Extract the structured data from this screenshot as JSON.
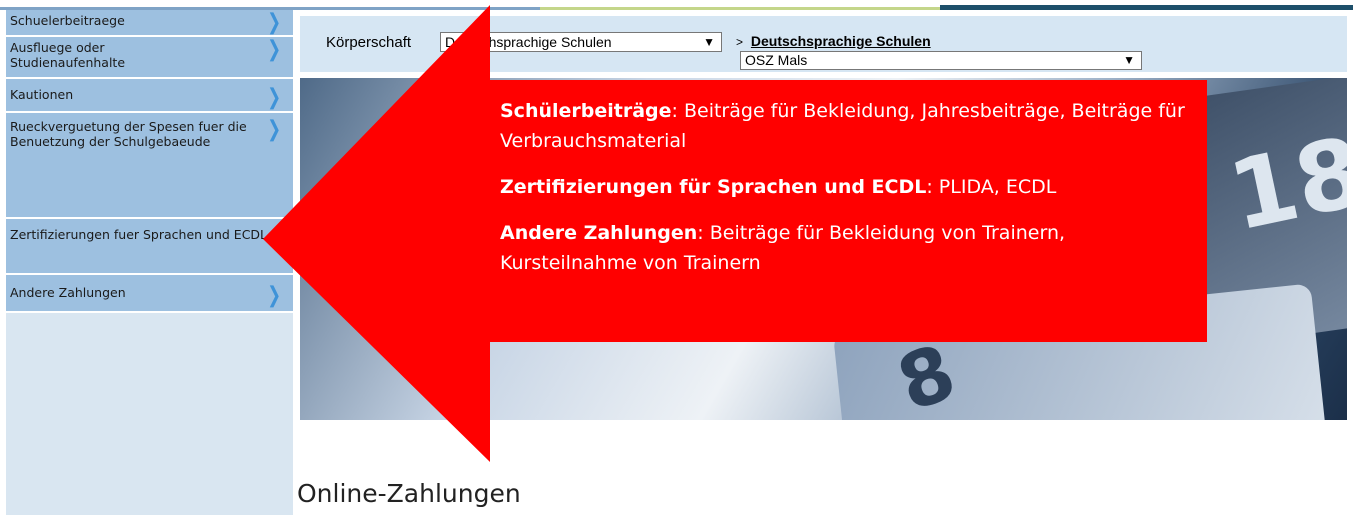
{
  "sidebar": {
    "items": [
      {
        "label": "Schuelerbeitraege"
      },
      {
        "label": "Ausfluege oder Studienaufenhalte"
      },
      {
        "label": "Kautionen"
      },
      {
        "label": "Rueckverguetung der Spesen fuer die Benuetzung der Schulgebaeude"
      },
      {
        "label": "Zertifizierungen fuer Sprachen und ECDL"
      },
      {
        "label": "Andere Zahlungen"
      }
    ]
  },
  "header": {
    "koerperschaft_label": "Körperschaft",
    "koerperschaft_value": "Deutschsprachige Schulen",
    "breadcrumb_sep": ">",
    "breadcrumb_link": "Deutschsprachige Schulen",
    "school_value": "OSZ Mals"
  },
  "callout": {
    "items": [
      {
        "term": "Schülerbeiträge",
        "text": ": Beiträge für Bekleidung, Jahresbeiträge, Beiträge für Verbrauchsmaterial"
      },
      {
        "term": "Zertifizierungen für Sprachen und ECDL",
        "text": ": PLIDA, ECDL"
      },
      {
        "term": "Andere Zahlungen",
        "text": ": Beiträge für Bekleidung von Trainern, Kursteilnahme von Trainern"
      }
    ]
  },
  "page_title": "Online-Zahlungen",
  "colors": {
    "annotation_red": "#ff0000",
    "sidebar_item": "#9dc0e0",
    "header_bg": "#d6e6f3",
    "chevron": "#3f93d8"
  }
}
